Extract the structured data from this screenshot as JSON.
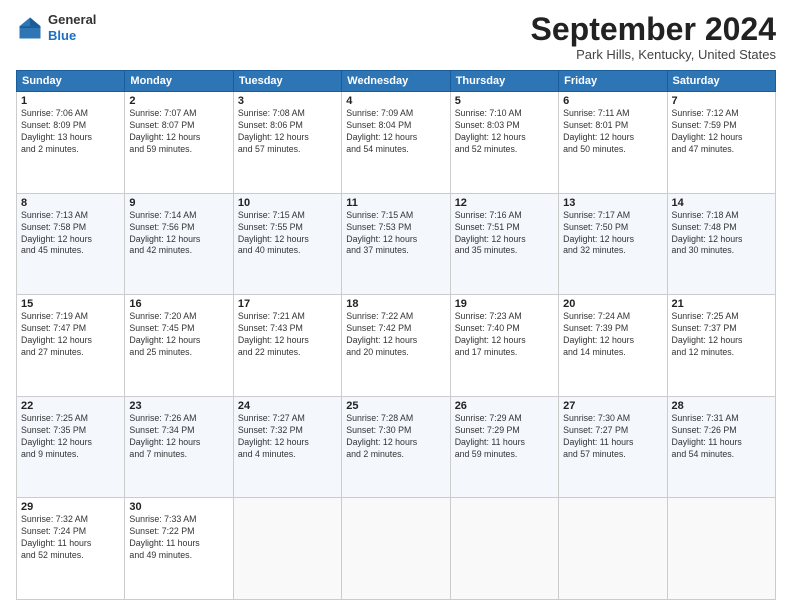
{
  "header": {
    "logo_line1": "General",
    "logo_line2": "Blue",
    "month_title": "September 2024",
    "location": "Park Hills, Kentucky, United States"
  },
  "days_of_week": [
    "Sunday",
    "Monday",
    "Tuesday",
    "Wednesday",
    "Thursday",
    "Friday",
    "Saturday"
  ],
  "weeks": [
    [
      {
        "num": "1",
        "lines": [
          "Sunrise: 7:06 AM",
          "Sunset: 8:09 PM",
          "Daylight: 13 hours",
          "and 2 minutes."
        ]
      },
      {
        "num": "2",
        "lines": [
          "Sunrise: 7:07 AM",
          "Sunset: 8:07 PM",
          "Daylight: 12 hours",
          "and 59 minutes."
        ]
      },
      {
        "num": "3",
        "lines": [
          "Sunrise: 7:08 AM",
          "Sunset: 8:06 PM",
          "Daylight: 12 hours",
          "and 57 minutes."
        ]
      },
      {
        "num": "4",
        "lines": [
          "Sunrise: 7:09 AM",
          "Sunset: 8:04 PM",
          "Daylight: 12 hours",
          "and 54 minutes."
        ]
      },
      {
        "num": "5",
        "lines": [
          "Sunrise: 7:10 AM",
          "Sunset: 8:03 PM",
          "Daylight: 12 hours",
          "and 52 minutes."
        ]
      },
      {
        "num": "6",
        "lines": [
          "Sunrise: 7:11 AM",
          "Sunset: 8:01 PM",
          "Daylight: 12 hours",
          "and 50 minutes."
        ]
      },
      {
        "num": "7",
        "lines": [
          "Sunrise: 7:12 AM",
          "Sunset: 7:59 PM",
          "Daylight: 12 hours",
          "and 47 minutes."
        ]
      }
    ],
    [
      {
        "num": "8",
        "lines": [
          "Sunrise: 7:13 AM",
          "Sunset: 7:58 PM",
          "Daylight: 12 hours",
          "and 45 minutes."
        ]
      },
      {
        "num": "9",
        "lines": [
          "Sunrise: 7:14 AM",
          "Sunset: 7:56 PM",
          "Daylight: 12 hours",
          "and 42 minutes."
        ]
      },
      {
        "num": "10",
        "lines": [
          "Sunrise: 7:15 AM",
          "Sunset: 7:55 PM",
          "Daylight: 12 hours",
          "and 40 minutes."
        ]
      },
      {
        "num": "11",
        "lines": [
          "Sunrise: 7:15 AM",
          "Sunset: 7:53 PM",
          "Daylight: 12 hours",
          "and 37 minutes."
        ]
      },
      {
        "num": "12",
        "lines": [
          "Sunrise: 7:16 AM",
          "Sunset: 7:51 PM",
          "Daylight: 12 hours",
          "and 35 minutes."
        ]
      },
      {
        "num": "13",
        "lines": [
          "Sunrise: 7:17 AM",
          "Sunset: 7:50 PM",
          "Daylight: 12 hours",
          "and 32 minutes."
        ]
      },
      {
        "num": "14",
        "lines": [
          "Sunrise: 7:18 AM",
          "Sunset: 7:48 PM",
          "Daylight: 12 hours",
          "and 30 minutes."
        ]
      }
    ],
    [
      {
        "num": "15",
        "lines": [
          "Sunrise: 7:19 AM",
          "Sunset: 7:47 PM",
          "Daylight: 12 hours",
          "and 27 minutes."
        ]
      },
      {
        "num": "16",
        "lines": [
          "Sunrise: 7:20 AM",
          "Sunset: 7:45 PM",
          "Daylight: 12 hours",
          "and 25 minutes."
        ]
      },
      {
        "num": "17",
        "lines": [
          "Sunrise: 7:21 AM",
          "Sunset: 7:43 PM",
          "Daylight: 12 hours",
          "and 22 minutes."
        ]
      },
      {
        "num": "18",
        "lines": [
          "Sunrise: 7:22 AM",
          "Sunset: 7:42 PM",
          "Daylight: 12 hours",
          "and 20 minutes."
        ]
      },
      {
        "num": "19",
        "lines": [
          "Sunrise: 7:23 AM",
          "Sunset: 7:40 PM",
          "Daylight: 12 hours",
          "and 17 minutes."
        ]
      },
      {
        "num": "20",
        "lines": [
          "Sunrise: 7:24 AM",
          "Sunset: 7:39 PM",
          "Daylight: 12 hours",
          "and 14 minutes."
        ]
      },
      {
        "num": "21",
        "lines": [
          "Sunrise: 7:25 AM",
          "Sunset: 7:37 PM",
          "Daylight: 12 hours",
          "and 12 minutes."
        ]
      }
    ],
    [
      {
        "num": "22",
        "lines": [
          "Sunrise: 7:25 AM",
          "Sunset: 7:35 PM",
          "Daylight: 12 hours",
          "and 9 minutes."
        ]
      },
      {
        "num": "23",
        "lines": [
          "Sunrise: 7:26 AM",
          "Sunset: 7:34 PM",
          "Daylight: 12 hours",
          "and 7 minutes."
        ]
      },
      {
        "num": "24",
        "lines": [
          "Sunrise: 7:27 AM",
          "Sunset: 7:32 PM",
          "Daylight: 12 hours",
          "and 4 minutes."
        ]
      },
      {
        "num": "25",
        "lines": [
          "Sunrise: 7:28 AM",
          "Sunset: 7:30 PM",
          "Daylight: 12 hours",
          "and 2 minutes."
        ]
      },
      {
        "num": "26",
        "lines": [
          "Sunrise: 7:29 AM",
          "Sunset: 7:29 PM",
          "Daylight: 11 hours",
          "and 59 minutes."
        ]
      },
      {
        "num": "27",
        "lines": [
          "Sunrise: 7:30 AM",
          "Sunset: 7:27 PM",
          "Daylight: 11 hours",
          "and 57 minutes."
        ]
      },
      {
        "num": "28",
        "lines": [
          "Sunrise: 7:31 AM",
          "Sunset: 7:26 PM",
          "Daylight: 11 hours",
          "and 54 minutes."
        ]
      }
    ],
    [
      {
        "num": "29",
        "lines": [
          "Sunrise: 7:32 AM",
          "Sunset: 7:24 PM",
          "Daylight: 11 hours",
          "and 52 minutes."
        ]
      },
      {
        "num": "30",
        "lines": [
          "Sunrise: 7:33 AM",
          "Sunset: 7:22 PM",
          "Daylight: 11 hours",
          "and 49 minutes."
        ]
      },
      null,
      null,
      null,
      null,
      null
    ]
  ]
}
